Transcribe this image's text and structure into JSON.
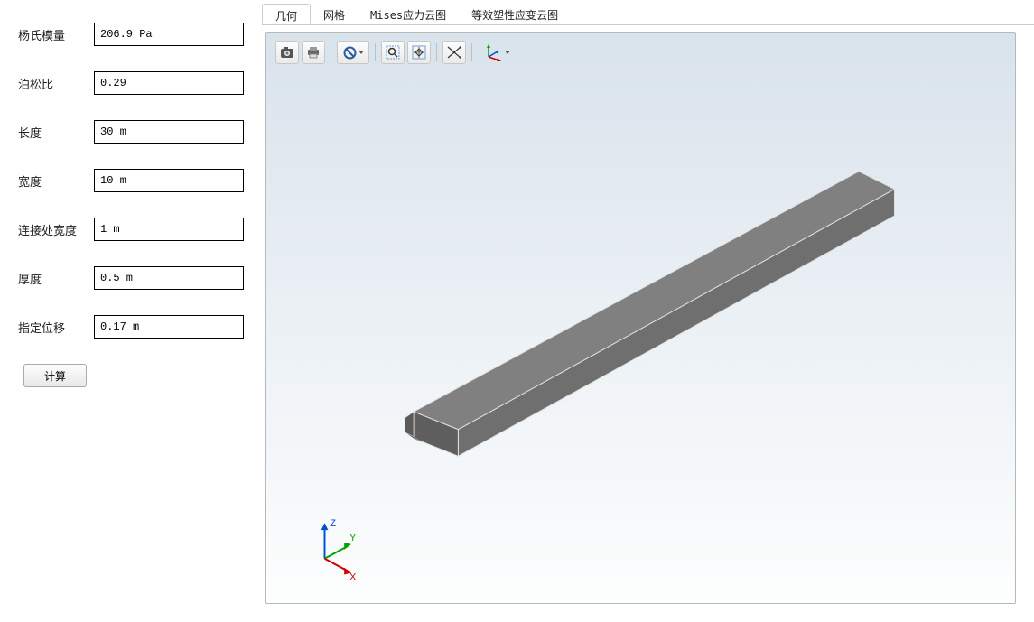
{
  "sidebar": {
    "fields": {
      "youngs_modulus": {
        "label": "杨氏模量",
        "value": "206.9 Pa"
      },
      "poisson_ratio": {
        "label": "泊松比",
        "value": "0.29"
      },
      "length": {
        "label": "长度",
        "value": "30 m"
      },
      "width": {
        "label": "宽度",
        "value": "10 m"
      },
      "joint_width": {
        "label": "连接处宽度",
        "value": "1 m"
      },
      "thickness": {
        "label": "厚度",
        "value": "0.5 m"
      },
      "displacement": {
        "label": "指定位移",
        "value": "0.17 m"
      }
    },
    "compute_label": "计算"
  },
  "tabs": {
    "items": [
      {
        "label": "几何",
        "active": true
      },
      {
        "label": "网格",
        "active": false
      },
      {
        "label": "Mises应力云图",
        "active": false
      },
      {
        "label": "等效塑性应变云图",
        "active": false
      }
    ]
  },
  "toolbar": {
    "camera": "camera-icon",
    "print": "print-icon",
    "forbid": "forbid-icon",
    "zoom": "zoom-icon",
    "fit": "fit-icon",
    "rotate": "rotate-icon",
    "axes": "axes-icon"
  },
  "axes": {
    "x": "X",
    "y": "Y",
    "z": "Z"
  }
}
